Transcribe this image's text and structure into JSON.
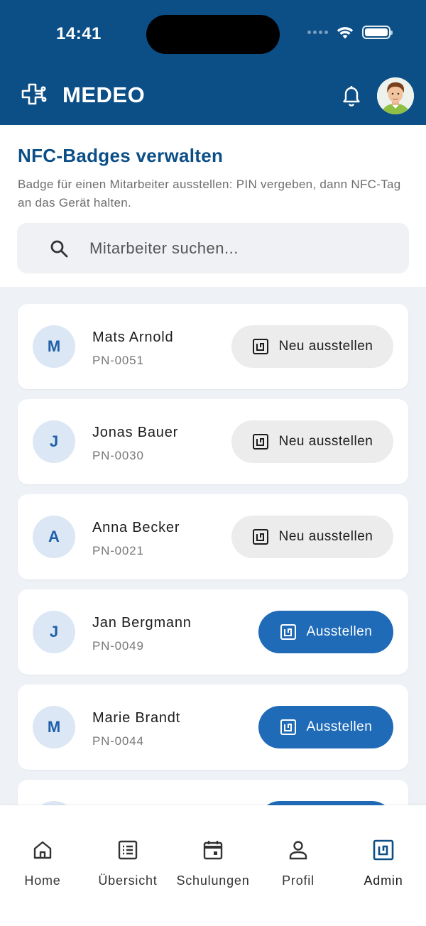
{
  "status_bar": {
    "time": "14:41"
  },
  "app": {
    "brand": "MEDEO"
  },
  "page": {
    "title": "NFC-Badges verwalten",
    "description": "Badge für einen Mitarbeiter ausstellen: PIN vergeben, dann NFC-Tag an das Gerät halten."
  },
  "search": {
    "placeholder": "Mitarbeiter suchen..."
  },
  "employees": [
    {
      "initial": "M",
      "name": "Mats Arnold",
      "pn": "PN-0051",
      "action": "Neu ausstellen",
      "issued": true
    },
    {
      "initial": "J",
      "name": "Jonas Bauer",
      "pn": "PN-0030",
      "action": "Neu ausstellen",
      "issued": true
    },
    {
      "initial": "A",
      "name": "Anna Becker",
      "pn": "PN-0021",
      "action": "Neu ausstellen",
      "issued": true
    },
    {
      "initial": "J",
      "name": "Jan Bergmann",
      "pn": "PN-0049",
      "action": "Ausstellen",
      "issued": false
    },
    {
      "initial": "M",
      "name": "Marie Brandt",
      "pn": "PN-0044",
      "action": "Ausstellen",
      "issued": false
    }
  ],
  "nav": [
    {
      "label": "Home",
      "icon": "home-icon",
      "active": false
    },
    {
      "label": "Übersicht",
      "icon": "list-icon",
      "active": false
    },
    {
      "label": "Schulungen",
      "icon": "calendar-icon",
      "active": false
    },
    {
      "label": "Profil",
      "icon": "person-icon",
      "active": false
    },
    {
      "label": "Admin",
      "icon": "nfc-icon",
      "active": true
    }
  ],
  "colors": {
    "primary": "#0c4f87",
    "accent_button": "#1f6bb8",
    "secondary_button": "#ececec",
    "list_background": "#eef1f6",
    "avatar_background": "#dce7f5"
  }
}
